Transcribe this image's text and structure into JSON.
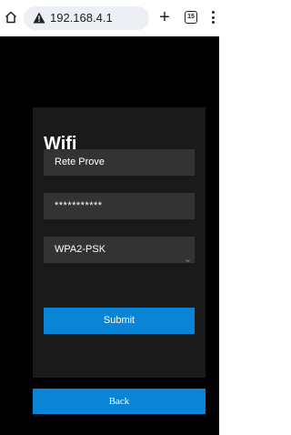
{
  "browser": {
    "url": "192.168.4.1",
    "tab_count": "15",
    "new_tab_label": "+"
  },
  "form": {
    "title": "Wifi",
    "ssid_value": "Rete Prove",
    "password_value": "***********",
    "security_value": "WPA2-PSK",
    "submit_label": "Submit"
  },
  "back_label": "Back",
  "colors": {
    "page_bg": "#000000",
    "card_bg": "#1a1a1a",
    "field_bg": "#333333",
    "accent": "#0a84d6",
    "text": "#ffffff"
  },
  "icons": {
    "home": "home-icon",
    "not_secure": "warning-icon",
    "tabs": "tab-switcher-icon",
    "menu": "more-vert-icon",
    "select_chevron": "chevron-down-icon"
  }
}
